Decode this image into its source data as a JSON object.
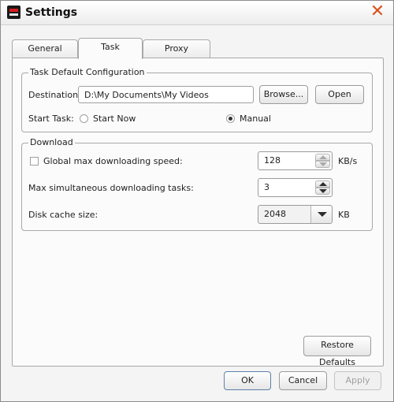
{
  "window": {
    "title": "Settings"
  },
  "tabs": [
    {
      "label": "General"
    },
    {
      "label": "Task"
    },
    {
      "label": "Proxy"
    }
  ],
  "task_config": {
    "group_title": "Task Default Configuration",
    "destination_label": "Destination:",
    "destination_value": "D:\\My Documents\\My Videos",
    "browse_label": "Browse...",
    "open_label": "Open",
    "start_task_label": "Start Task:",
    "start_now_label": "Start Now",
    "start_now_checked": false,
    "manual_label": "Manual",
    "manual_checked": true
  },
  "download": {
    "group_title": "Download",
    "speed_label": "Global max downloading speed:",
    "speed_checked": false,
    "speed_value": "128",
    "speed_unit": "KB/s",
    "tasks_label": "Max simultaneous downloading tasks:",
    "tasks_value": "3",
    "cache_label": "Disk cache size:",
    "cache_value": "2048",
    "cache_unit": "KB"
  },
  "buttons": {
    "restore_defaults": "Restore Defaults",
    "ok": "OK",
    "cancel": "Cancel",
    "apply": "Apply"
  },
  "icons": {
    "close": "close-icon",
    "app": "app-icon"
  }
}
